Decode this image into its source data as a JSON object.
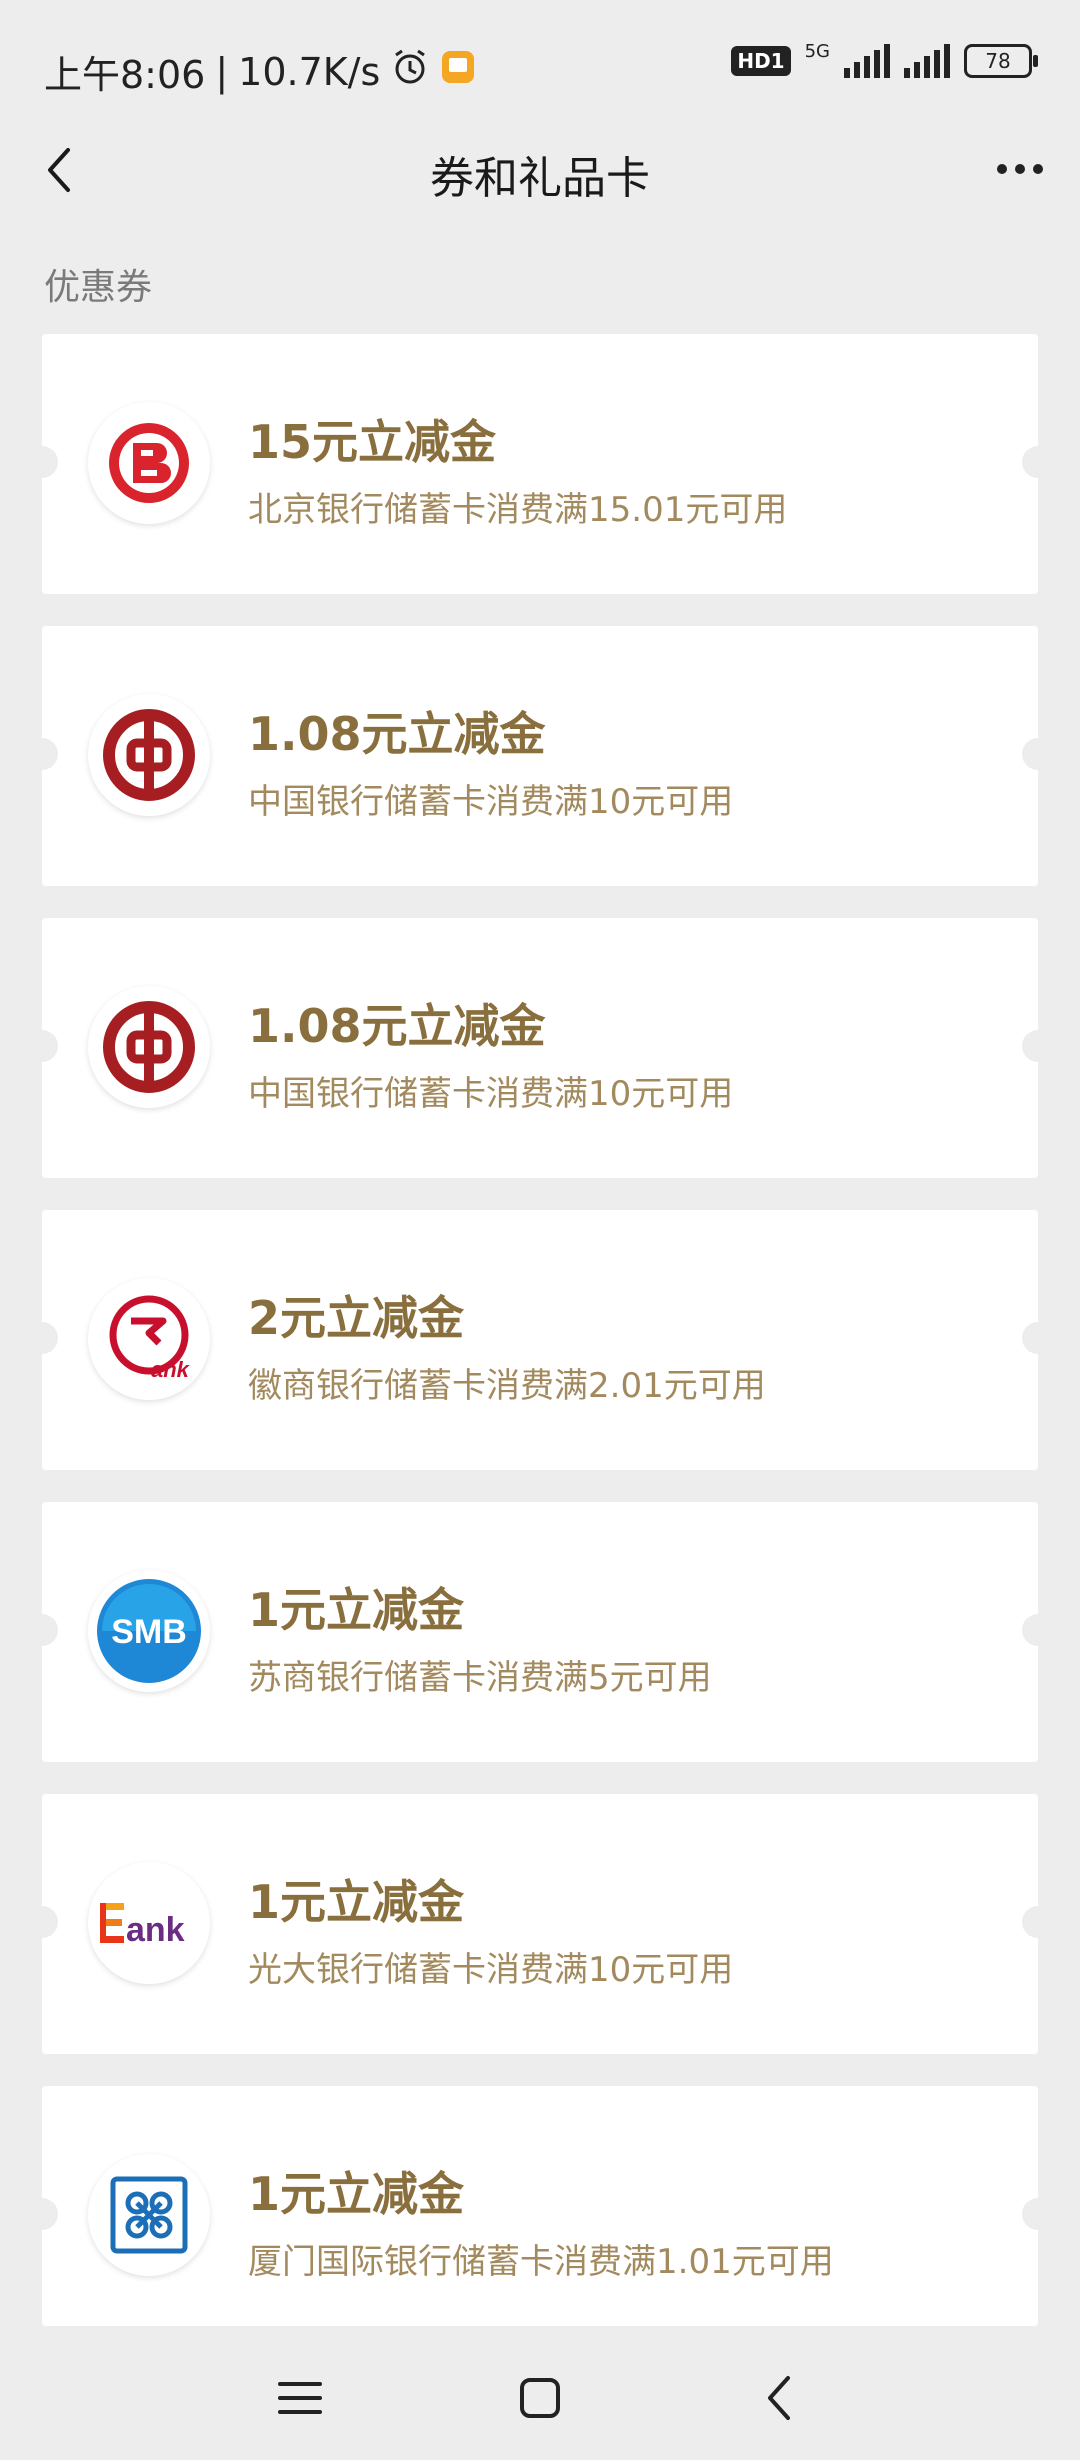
{
  "status_bar": {
    "time": "上午8:06",
    "speed": "10.7K/s",
    "hd_badge": "HD1",
    "network": "5G",
    "battery": "78"
  },
  "nav": {
    "title": "券和礼品卡"
  },
  "section": {
    "label": "优惠券"
  },
  "coupons": [
    {
      "title": "15元立减金",
      "desc": "北京银行储蓄卡消费满15.01元可用",
      "logo": "bank-of-beijing-logo"
    },
    {
      "title": "1.08元立减金",
      "desc": "中国银行储蓄卡消费满10元可用",
      "logo": "bank-of-china-logo"
    },
    {
      "title": "1.08元立减金",
      "desc": "中国银行储蓄卡消费满10元可用",
      "logo": "bank-of-china-logo"
    },
    {
      "title": "2元立减金",
      "desc": "徽商银行储蓄卡消费满2.01元可用",
      "logo": "huishang-bank-logo"
    },
    {
      "title": "1元立减金",
      "desc": "苏商银行储蓄卡消费满5元可用",
      "logo": "suning-bank-logo"
    },
    {
      "title": "1元立减金",
      "desc": "光大银行储蓄卡消费满10元可用",
      "logo": "everbright-bank-logo"
    },
    {
      "title": "1元立减金",
      "desc": "厦门国际银行储蓄卡消费满1.01元可用",
      "logo": "xiamen-intl-bank-logo"
    }
  ],
  "logo_text": {
    "smb": "SMB",
    "ank": "ank",
    "e_letter": "E"
  },
  "colors": {
    "accent_gold": "#8a6f3e",
    "bank_red": "#c8102e",
    "smb_blue": "#1e88d6"
  }
}
